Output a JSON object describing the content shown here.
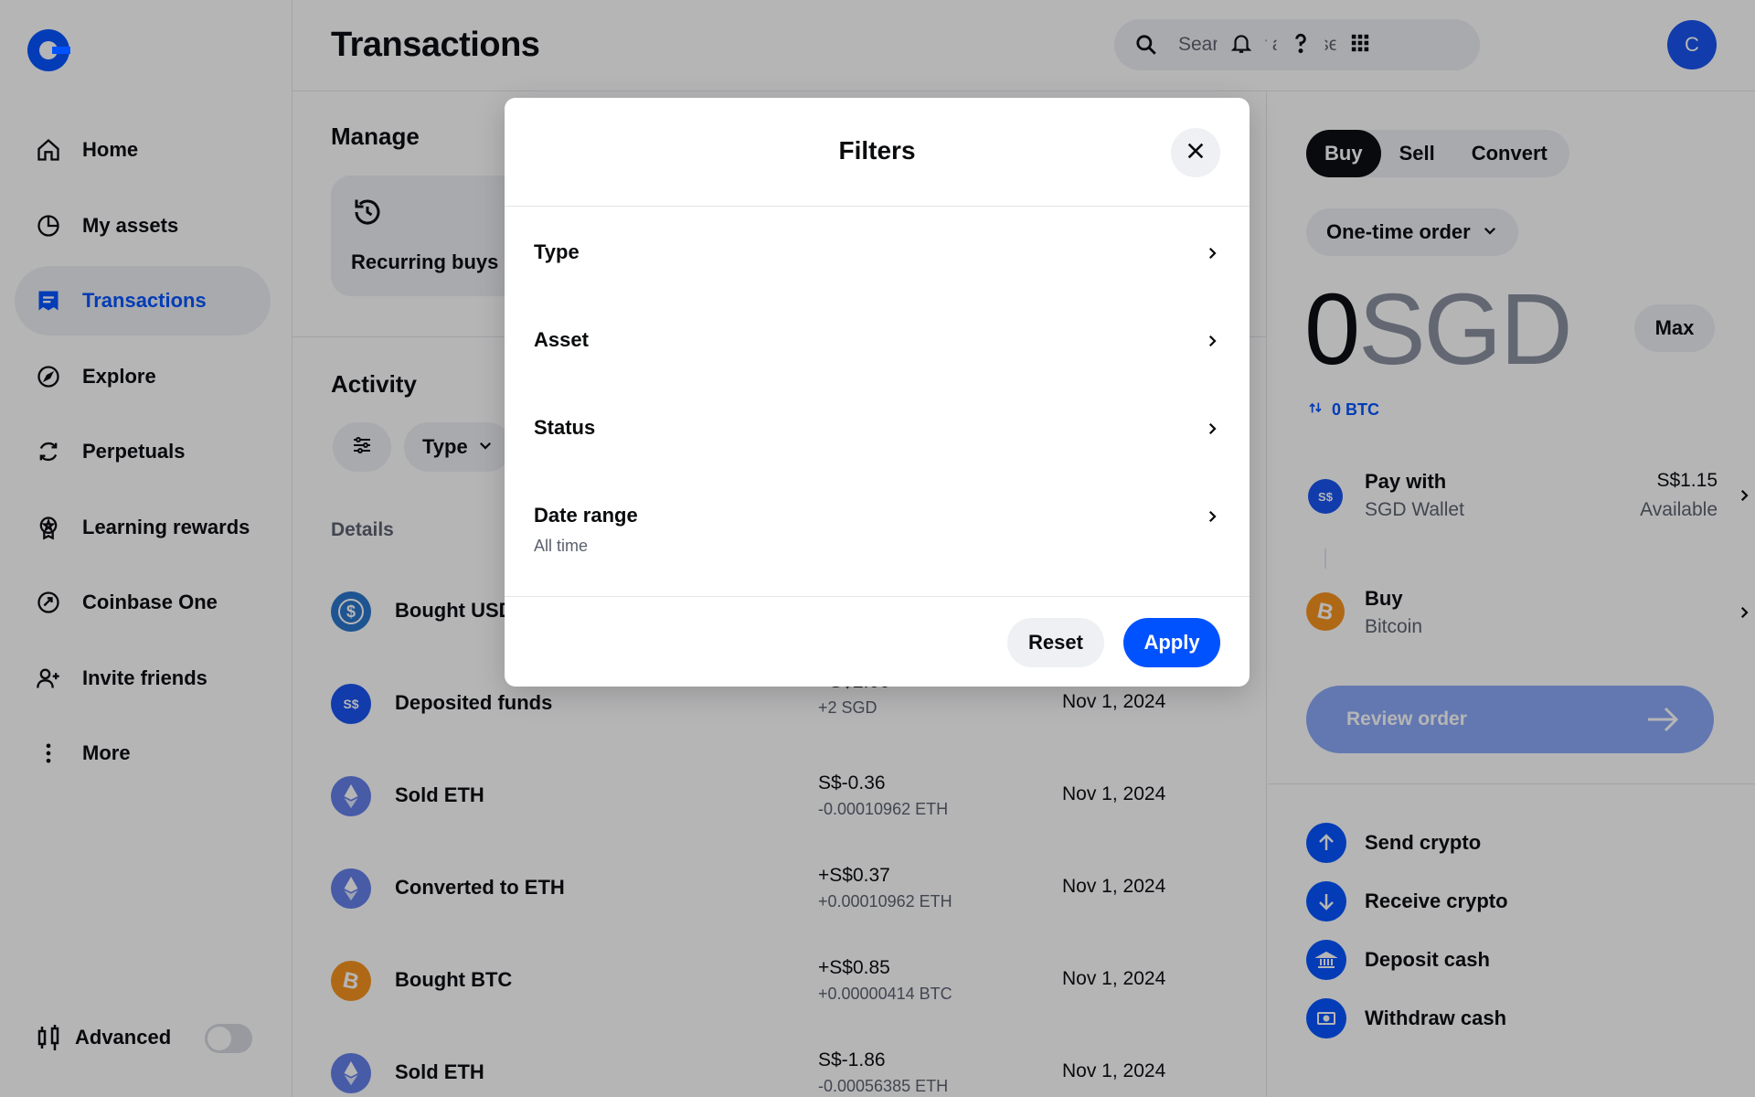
{
  "header": {
    "title": "Transactions",
    "search_placeholder": "Search for an asset",
    "avatar_initial": "C"
  },
  "sidebar": {
    "items": [
      {
        "label": "Home",
        "icon": "home-icon"
      },
      {
        "label": "My assets",
        "icon": "pie-chart-icon"
      },
      {
        "label": "Transactions",
        "icon": "receipt-icon",
        "active": true
      },
      {
        "label": "Explore",
        "icon": "compass-icon"
      },
      {
        "label": "Perpetuals",
        "icon": "refresh-icon"
      },
      {
        "label": "Learning rewards",
        "icon": "reward-icon"
      },
      {
        "label": "Coinbase One",
        "icon": "coinbase-one-icon"
      },
      {
        "label": "Invite friends",
        "icon": "add-user-icon"
      },
      {
        "label": "More",
        "icon": "more-vertical-icon"
      }
    ],
    "advanced_label": "Advanced"
  },
  "main": {
    "manage_heading": "Manage",
    "recurring_buys": "Recurring buys",
    "activity_heading": "Activity",
    "type_filter": "Type",
    "details_heading": "Details",
    "transactions": [
      {
        "name": "Bought USD",
        "amount": "",
        "sub": "",
        "date": "",
        "coin": "USDC",
        "color": "#2775ca"
      },
      {
        "name": "Deposited funds",
        "amount": "+S$2.00",
        "sub": "+2 SGD",
        "date": "Nov 1, 2024",
        "coin": "S$",
        "color": "#1652f0"
      },
      {
        "name": "Sold ETH",
        "amount": "S$-0.36",
        "sub": "-0.00010962 ETH",
        "date": "Nov 1, 2024",
        "coin": "ETH",
        "color": "#627eea"
      },
      {
        "name": "Converted to ETH",
        "amount": "+S$0.37",
        "sub": "+0.00010962 ETH",
        "date": "Nov 1, 2024",
        "coin": "ETH",
        "color": "#627eea"
      },
      {
        "name": "Bought BTC",
        "amount": "+S$0.85",
        "sub": "+0.00000414 BTC",
        "date": "Nov 1, 2024",
        "coin": "BTC",
        "color": "#f7931a"
      },
      {
        "name": "Sold ETH",
        "amount": "S$-1.86",
        "sub": "-0.00056385 ETH",
        "date": "Nov 1, 2024",
        "coin": "ETH",
        "color": "#627eea"
      }
    ]
  },
  "trade": {
    "tabs": [
      "Buy",
      "Sell",
      "Convert"
    ],
    "active_tab": "Buy",
    "order_type": "One-time order",
    "amount": "0",
    "currency": "SGD",
    "max_label": "Max",
    "conversion": "0 BTC",
    "pay_with_label": "Pay with",
    "pay_with_value": "SGD Wallet",
    "balance": "S$1.15",
    "balance_sub": "Available",
    "buy_label": "Buy",
    "buy_asset": "Bitcoin",
    "review_button": "Review order",
    "actions": [
      "Send crypto",
      "Receive crypto",
      "Deposit cash",
      "Withdraw cash"
    ]
  },
  "modal": {
    "title": "Filters",
    "rows": [
      {
        "label": "Type",
        "sub": ""
      },
      {
        "label": "Asset",
        "sub": ""
      },
      {
        "label": "Status",
        "sub": ""
      },
      {
        "label": "Date range",
        "sub": "All time"
      }
    ],
    "reset_label": "Reset",
    "apply_label": "Apply"
  },
  "colors": {
    "brand": "#0052ff",
    "overlay": "rgba(10,11,13,0.30)"
  }
}
